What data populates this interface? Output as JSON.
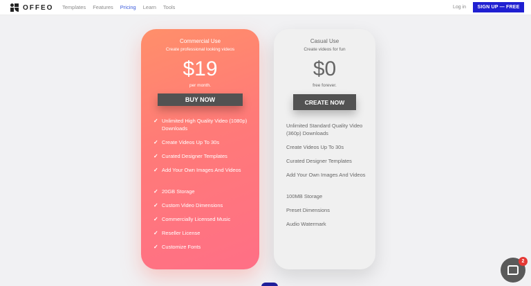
{
  "brand": {
    "name": "OFFEO"
  },
  "nav": {
    "links": [
      "Templates",
      "Features",
      "Pricing",
      "Learn",
      "Tools"
    ],
    "active": "Pricing",
    "login": "Log in",
    "signup": "SIGN UP — FREE"
  },
  "plans": {
    "commercial": {
      "name": "Commercial Use",
      "subtitle": "Create professional looking videos",
      "price": "$19",
      "period": "per month.",
      "cta": "BUY NOW",
      "features": [
        "Unlimited High Quality Video (1080p) Downloads",
        "Create Videos Up To 30s",
        "Curated Designer Templates",
        "Add Your Own Images And Videos",
        "20GB Storage",
        "Custom Video Dimensions",
        "Commercially Licensed Music",
        "Reseller License",
        "Customize Fonts"
      ]
    },
    "casual": {
      "name": "Casual Use",
      "subtitle": "Create videos for fun",
      "price": "$0",
      "period": "free forever.",
      "cta": "CREATE NOW",
      "features": [
        "Unlimited Standard Quality Video (360p) Downloads",
        "Create Videos Up To 30s",
        "Curated Designer Templates",
        "Add Your Own Images And Videos",
        "100MB Storage",
        "Preset Dimensions",
        "Audio Watermark"
      ]
    }
  },
  "chat": {
    "badge": "2"
  },
  "colors": {
    "accent": "#1f1fd1",
    "commercial_gradient_start": "#ff8f6a",
    "commercial_gradient_end": "#ff6f86",
    "button": "#525252"
  }
}
